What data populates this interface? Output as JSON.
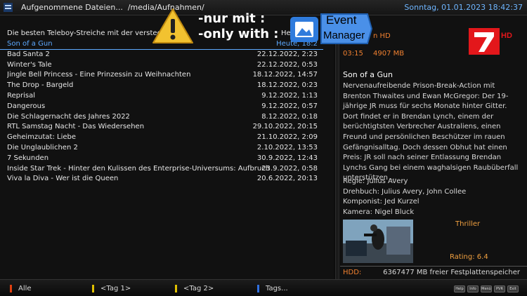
{
  "header": {
    "title": "Aufgenommene Dateien...  /media/Aufnahmen/",
    "clock": "Sonntag, 01.01.2023  18:42:37"
  },
  "list": {
    "description_line": "Die besten Teleboy-Streiche mit der versteckten",
    "description_line_tail": "Heu",
    "rows": [
      {
        "title": "Son of a Gun",
        "date": "Heute, 18:2",
        "selected": true
      },
      {
        "title": "Bad Santa 2",
        "date": "22.12.2022, 2:23"
      },
      {
        "title": "Winter's Tale",
        "date": "22.12.2022, 0:53"
      },
      {
        "title": "Jingle Bell Princess - Eine Prinzessin zu Weihnachten",
        "date": "18.12.2022, 14:57"
      },
      {
        "title": "The Drop - Bargeld",
        "date": "18.12.2022, 0:23"
      },
      {
        "title": "Reprisal",
        "date": "9.12.2022, 1:13"
      },
      {
        "title": "Dangerous",
        "date": "9.12.2022, 0:57"
      },
      {
        "title": "Die Schlagernacht des Jahres 2022",
        "date": "8.12.2022, 0:18"
      },
      {
        "title": "RTL Samstag Nacht - Das Wiedersehen",
        "date": "29.10.2022, 20:15"
      },
      {
        "title": "Geheimzutat: Liebe",
        "date": "21.10.2022, 2:09"
      },
      {
        "title": "Die Unglaublichen 2",
        "date": "2.10.2022, 13:53"
      },
      {
        "title": "7 Sekunden",
        "date": "30.9.2022, 12:43"
      },
      {
        "title": "Inside Star Trek - Hinter den Kulissen des Enterprise-Universums: Aufbruch ins nächs",
        "date": "23.9.2022, 0:58"
      },
      {
        "title": "Viva la Diva - Wer ist die Queen",
        "date": "20.6.2022, 20:13"
      }
    ]
  },
  "details": {
    "channel": "n HD",
    "duration": "03:15",
    "size": "4907 MB",
    "channel_logo_label": "HD",
    "title": "Son of a Gun",
    "description": "Nervenaufreibende Prison-Break-Action mit Brenton Thwaites und Ewan McGregor: Der 19-jährige JR muss für sechs Monate hinter Gitter. Dort findet er in Brendan Lynch, einem der berüchtigtsten Verbrecher Australiens, einen Freund und persönlichen Beschützer im rauen Gefängnisalltag. Doch dessen Obhut hat einen Preis: JR soll nach seiner Entlassung Brendan Lynchs Gang bei einem waghalsigen Raubüberfall unterstützen ...",
    "credits": [
      "Regie: Julius Avery",
      "Drehbuch: Julius Avery, John Collee",
      "Komponist: Jed Kurzel",
      "Kamera: Nigel Bluck"
    ],
    "genre": "Thriller",
    "rating": "Rating: 6.4",
    "hdd_label": "HDD:",
    "hdd_value": "6367477 MB freier Festplattenspeicher"
  },
  "footer": {
    "keys": [
      {
        "label": "Alle",
        "color": "#e04010"
      },
      {
        "label": "<Tag 1>",
        "color": "#e0c000"
      },
      {
        "label": "<Tag 2>",
        "color": "#e0c000"
      },
      {
        "label": "Tags...",
        "color": "#3070e0"
      }
    ],
    "buttons": [
      "Help",
      "Info",
      "Menü",
      "PVR",
      "Exit"
    ]
  },
  "overlay": {
    "line1": "-nur mit :",
    "line2": "-only with :",
    "badge_line1": "Event",
    "badge_line2": "Manager"
  }
}
